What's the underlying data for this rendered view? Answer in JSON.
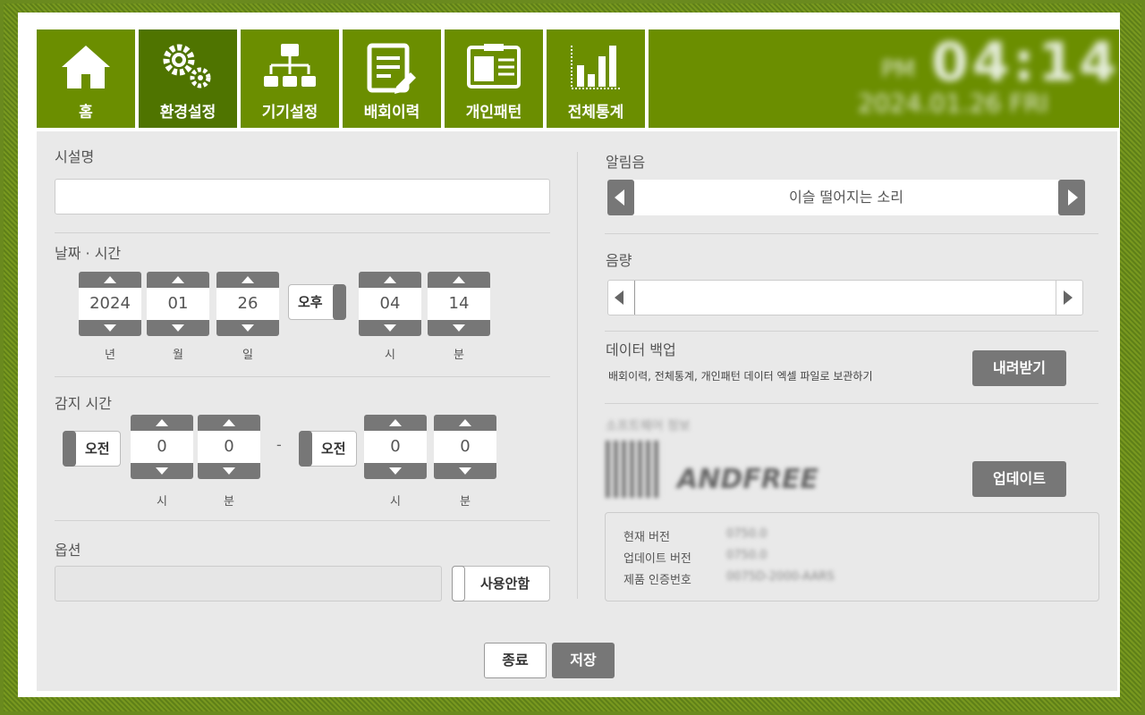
{
  "nav": {
    "tabs": [
      {
        "label": "홈",
        "icon": "home-icon"
      },
      {
        "label": "환경설정",
        "icon": "gears-icon"
      },
      {
        "label": "기기설정",
        "icon": "hierarchy-icon"
      },
      {
        "label": "배회이력",
        "icon": "clipboard-icon"
      },
      {
        "label": "개인패턴",
        "icon": "id-card-icon"
      },
      {
        "label": "전체통계",
        "icon": "bar-chart-icon"
      }
    ],
    "active_tab": "환경설정",
    "clock": {
      "ampm": "PM",
      "time": "04:14",
      "date": "2024.01.26 FRI"
    }
  },
  "facility": {
    "label": "시설명",
    "value": ""
  },
  "datetime": {
    "label": "날짜 · 시간",
    "year": "2024",
    "month": "01",
    "day": "26",
    "ampm": "오후",
    "hour": "04",
    "minute": "14",
    "units": {
      "year": "년",
      "month": "월",
      "day": "일",
      "hour": "시",
      "minute": "분"
    }
  },
  "detect": {
    "label": "감지 시간",
    "start": {
      "ampm": "오전",
      "hour": "0",
      "minute": "0"
    },
    "separator": "-",
    "end": {
      "ampm": "오전",
      "hour": "0",
      "minute": "0"
    },
    "units": {
      "hour": "시",
      "minute": "분"
    }
  },
  "option": {
    "label": "옵션",
    "value": "",
    "toggle": "사용안함"
  },
  "alarm": {
    "label": "알림음",
    "value": "이슬 떨어지는 소리"
  },
  "volume": {
    "label": "음량",
    "level": 0.0
  },
  "backup": {
    "label": "데이터 백업",
    "desc": "배회이력, 전체통계, 개인패턴 데이터 엑셀 파일로 보관하기",
    "button": "내려받기"
  },
  "software": {
    "label": "소프트웨어 정보",
    "logo_text": "ANDFREE",
    "update_button": "업데이트",
    "info": [
      {
        "key": "현재 버전",
        "value": "0750.0"
      },
      {
        "key": "업데이트 버전",
        "value": "0750.0"
      },
      {
        "key": "제품 인증번호",
        "value": "0075D-2000-AARS"
      }
    ]
  },
  "footer": {
    "close": "종료",
    "save": "저장"
  },
  "colors": {
    "nav_green": "#6b8e00",
    "nav_active": "#4f7400",
    "button_gray": "#777777",
    "panel_bg": "#e9e9e9"
  }
}
